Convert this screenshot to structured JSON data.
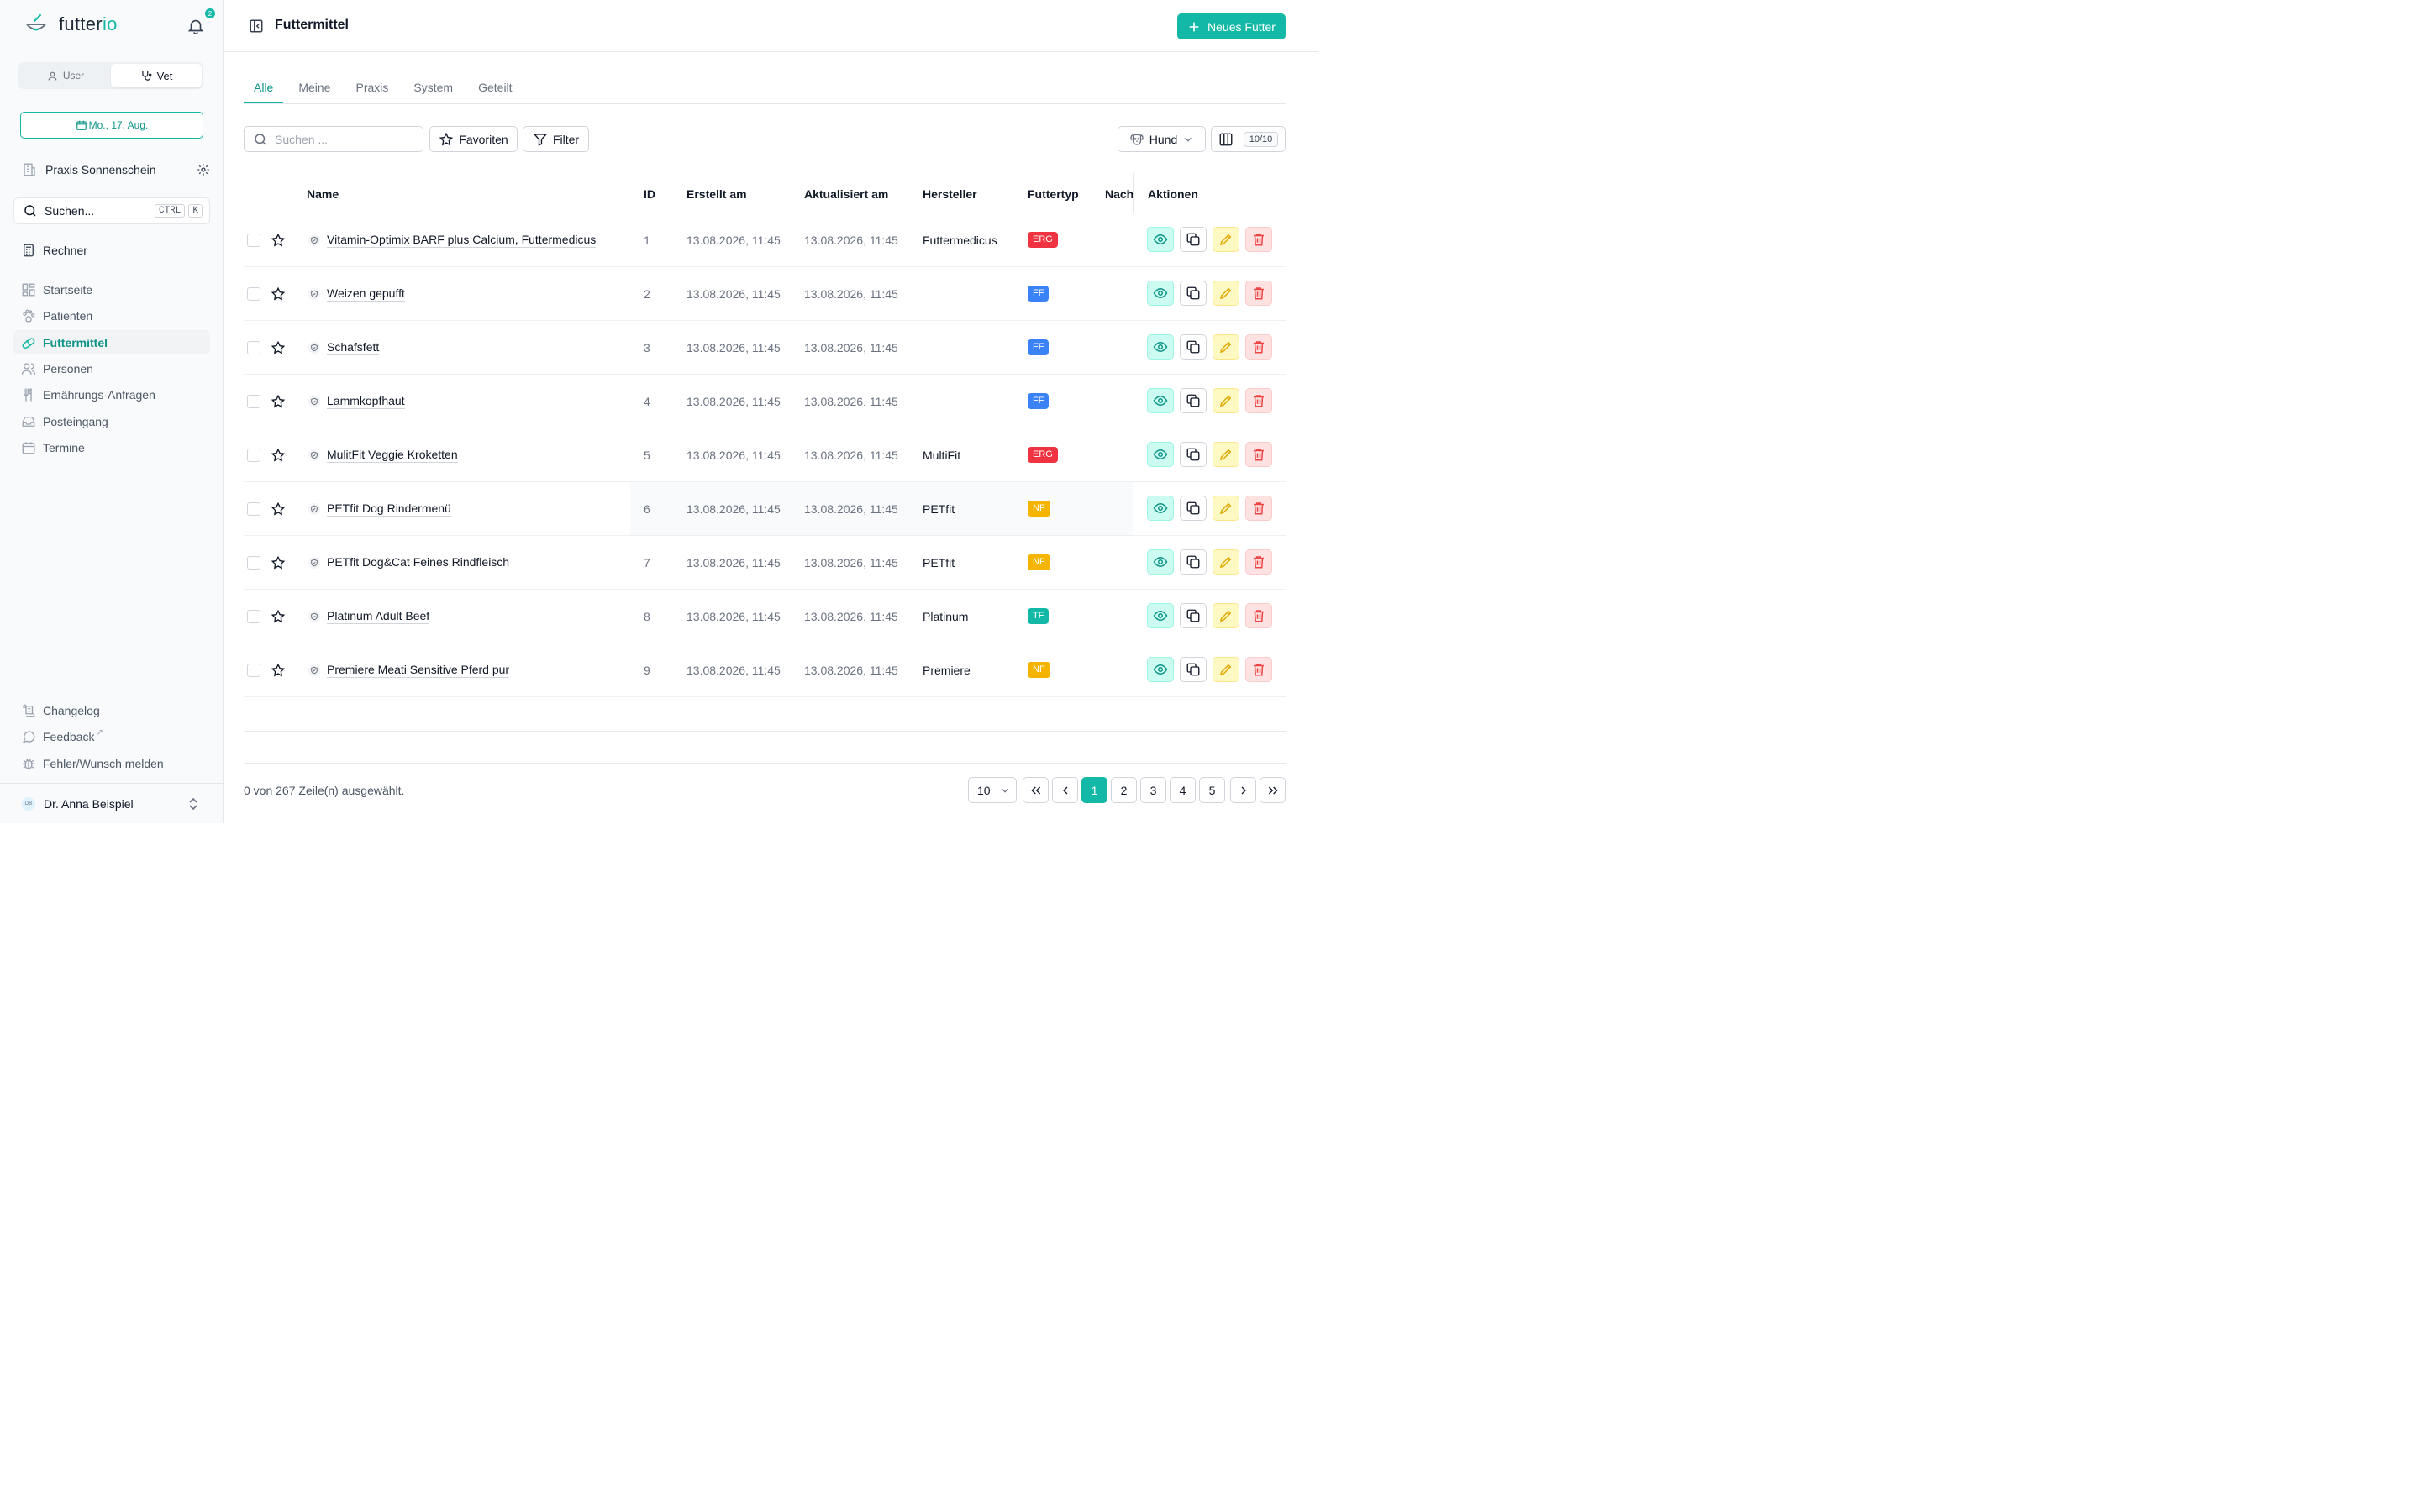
{
  "brand": {
    "name_part1": "futter",
    "name_part2": "io",
    "notification_count": "2"
  },
  "roles": {
    "user_label": "User",
    "vet_label": "Vet",
    "active": "Vet"
  },
  "date_label": "Mo., 17. Aug.",
  "practice_name": "Praxis Sonnenschein",
  "side_search": {
    "placeholder": "Suchen...",
    "kbd1": "CTRL",
    "kbd2": "K"
  },
  "calculator_label": "Rechner",
  "nav": [
    {
      "label": "Startseite",
      "icon": "dashboard-icon"
    },
    {
      "label": "Patienten",
      "icon": "paw-icon"
    },
    {
      "label": "Futtermittel",
      "icon": "pill-icon",
      "active": true
    },
    {
      "label": "Personen",
      "icon": "users-icon"
    },
    {
      "label": "Ernährungs-Anfragen",
      "icon": "utensils-icon"
    },
    {
      "label": "Posteingang",
      "icon": "inbox-icon"
    },
    {
      "label": "Termine",
      "icon": "calendar-icon"
    }
  ],
  "footer_nav": [
    {
      "label": "Changelog",
      "icon": "scroll-icon"
    },
    {
      "label": "Feedback",
      "icon": "message-icon",
      "suffix": "↗"
    },
    {
      "label": "Fehler/Wunsch melden",
      "icon": "bug-icon"
    }
  ],
  "user": {
    "initials": "DB",
    "name": "Dr. Anna Beispiel"
  },
  "page_title": "Futtermittel",
  "new_button_label": "Neues Futter",
  "tabs": [
    "Alle",
    "Meine",
    "Praxis",
    "System",
    "Geteilt"
  ],
  "active_tab": "Alle",
  "toolbar": {
    "search_placeholder": "Suchen ...",
    "favorites_label": "Favoriten",
    "filter_label": "Filter",
    "species_label": "Hund",
    "columns_count": "10/10"
  },
  "columns": {
    "name": "Name",
    "id": "ID",
    "created": "Erstellt am",
    "updated": "Aktualisiert am",
    "manufacturer": "Hersteller",
    "type": "Futtertyp",
    "next": "Nach",
    "actions": "Aktionen"
  },
  "rows": [
    {
      "name": "Vitamin-Optimix BARF plus Calcium, Futtermedicus",
      "id": "1",
      "created": "13.08.2026, 11:45",
      "updated": "13.08.2026, 11:45",
      "manufacturer": "Futtermedicus",
      "type": "ERG"
    },
    {
      "name": "Weizen gepufft",
      "id": "2",
      "created": "13.08.2026, 11:45",
      "updated": "13.08.2026, 11:45",
      "manufacturer": "",
      "type": "FF"
    },
    {
      "name": "Schafsfett",
      "id": "3",
      "created": "13.08.2026, 11:45",
      "updated": "13.08.2026, 11:45",
      "manufacturer": "",
      "type": "FF"
    },
    {
      "name": "Lammkopfhaut",
      "id": "4",
      "created": "13.08.2026, 11:45",
      "updated": "13.08.2026, 11:45",
      "manufacturer": "",
      "type": "FF"
    },
    {
      "name": "MulitFit Veggie Kroketten",
      "id": "5",
      "created": "13.08.2026, 11:45",
      "updated": "13.08.2026, 11:45",
      "manufacturer": "MultiFit",
      "type": "ERG"
    },
    {
      "name": "PETfit Dog Rindermenü",
      "id": "6",
      "created": "13.08.2026, 11:45",
      "updated": "13.08.2026, 11:45",
      "manufacturer": "PETfit",
      "type": "NF"
    },
    {
      "name": "PETfit Dog&Cat Feines Rindfleisch",
      "id": "7",
      "created": "13.08.2026, 11:45",
      "updated": "13.08.2026, 11:45",
      "manufacturer": "PETfit",
      "type": "NF"
    },
    {
      "name": "Platinum Adult Beef",
      "id": "8",
      "created": "13.08.2026, 11:45",
      "updated": "13.08.2026, 11:45",
      "manufacturer": "Platinum",
      "type": "TF"
    },
    {
      "name": "Premiere Meati Sensitive Pferd pur",
      "id": "9",
      "created": "13.08.2026, 11:45",
      "updated": "13.08.2026, 11:45",
      "manufacturer": "Premiere",
      "type": "NF"
    }
  ],
  "type_colors": {
    "ERG": "#ef3340",
    "FF": "#3b82f6",
    "NF": "#f5b400",
    "TF": "#14b8a6"
  },
  "accent": "#14b8a6",
  "selection_text": "0 von 267 Zeile(n) ausgewählt.",
  "page_size": "10",
  "pages": [
    "1",
    "2",
    "3",
    "4",
    "5"
  ],
  "current_page": "1"
}
